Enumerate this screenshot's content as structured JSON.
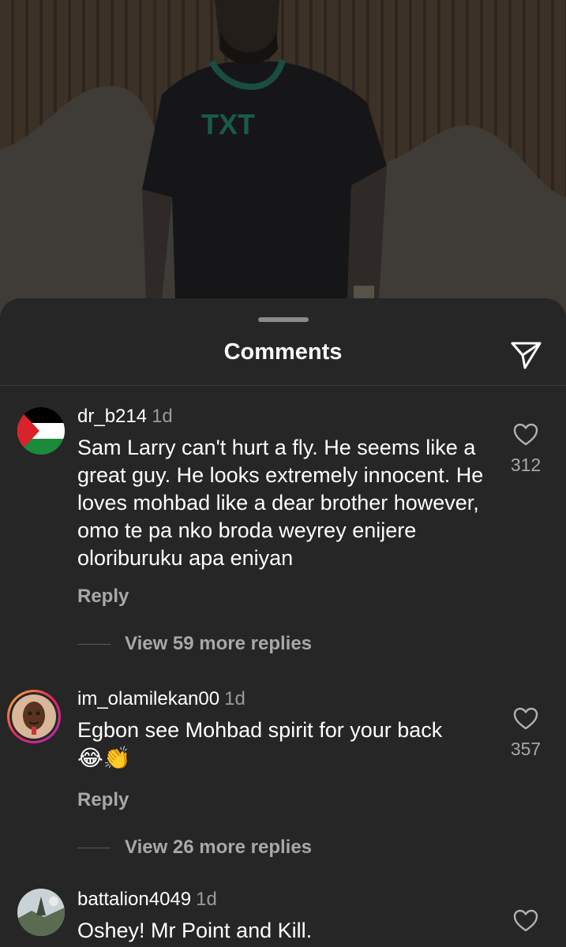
{
  "sheet": {
    "title": "Comments"
  },
  "comments": [
    {
      "username": "dr_b214",
      "time": "1d",
      "text": "Sam Larry can't hurt a fly. He seems like a great guy. He looks extremely innocent. He loves mohbad like a dear brother however, omo te pa nko broda weyrey enijere oloriburuku apa eniyan",
      "likes": "312",
      "reply_label": "Reply",
      "view_replies": "View 59 more replies",
      "avatar": "palestine-flag-avatar"
    },
    {
      "username": "im_olamilekan00",
      "time": "1d",
      "text": "Egbon see Mohbad spirit for your back",
      "emojis": "😂👏",
      "likes": "357",
      "reply_label": "Reply",
      "view_replies": "View 26 more replies",
      "avatar": "person-photo-avatar"
    },
    {
      "username": "battalion4049",
      "time": "1d",
      "text": "Oshey! Mr Point and Kill.",
      "avatar": "landscape-photo-avatar"
    }
  ],
  "icons": {
    "share": "paper-plane-icon",
    "like": "heart-outline-icon"
  },
  "colors": {
    "sheet_bg": "#262626",
    "text_primary": "#ffffff",
    "text_secondary": "#a8a8a8"
  }
}
